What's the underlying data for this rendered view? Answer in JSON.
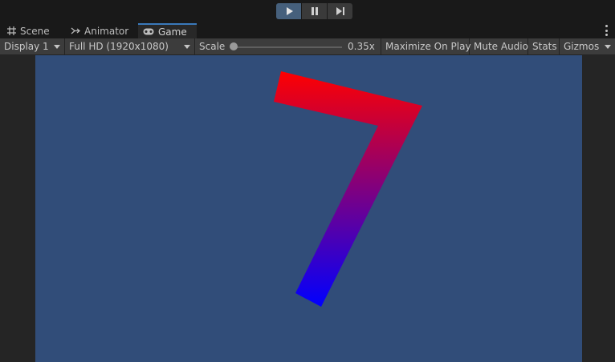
{
  "playbar": {
    "play_icon": "play-icon",
    "pause_icon": "pause-icon",
    "step_icon": "step-icon",
    "active_color": "#46607c"
  },
  "tabs": [
    {
      "label": "Scene",
      "icon": "grid-icon"
    },
    {
      "label": "Animator",
      "icon": "animator-icon"
    },
    {
      "label": "Game",
      "icon": "gamepad-icon",
      "active": true
    }
  ],
  "toolbar": {
    "display": "Display 1",
    "resolution": "Full HD (1920x1080)",
    "scale_label": "Scale",
    "scale_value": "0.35x",
    "scale_fraction": 0.0,
    "maximize": "Maximize On Play",
    "mute": "Mute Audio",
    "stats": "Stats",
    "gizmos": "Gizmos"
  },
  "game": {
    "background": "#314d79",
    "shape_gradient": [
      "#ff0000",
      "#0000ff"
    ]
  }
}
